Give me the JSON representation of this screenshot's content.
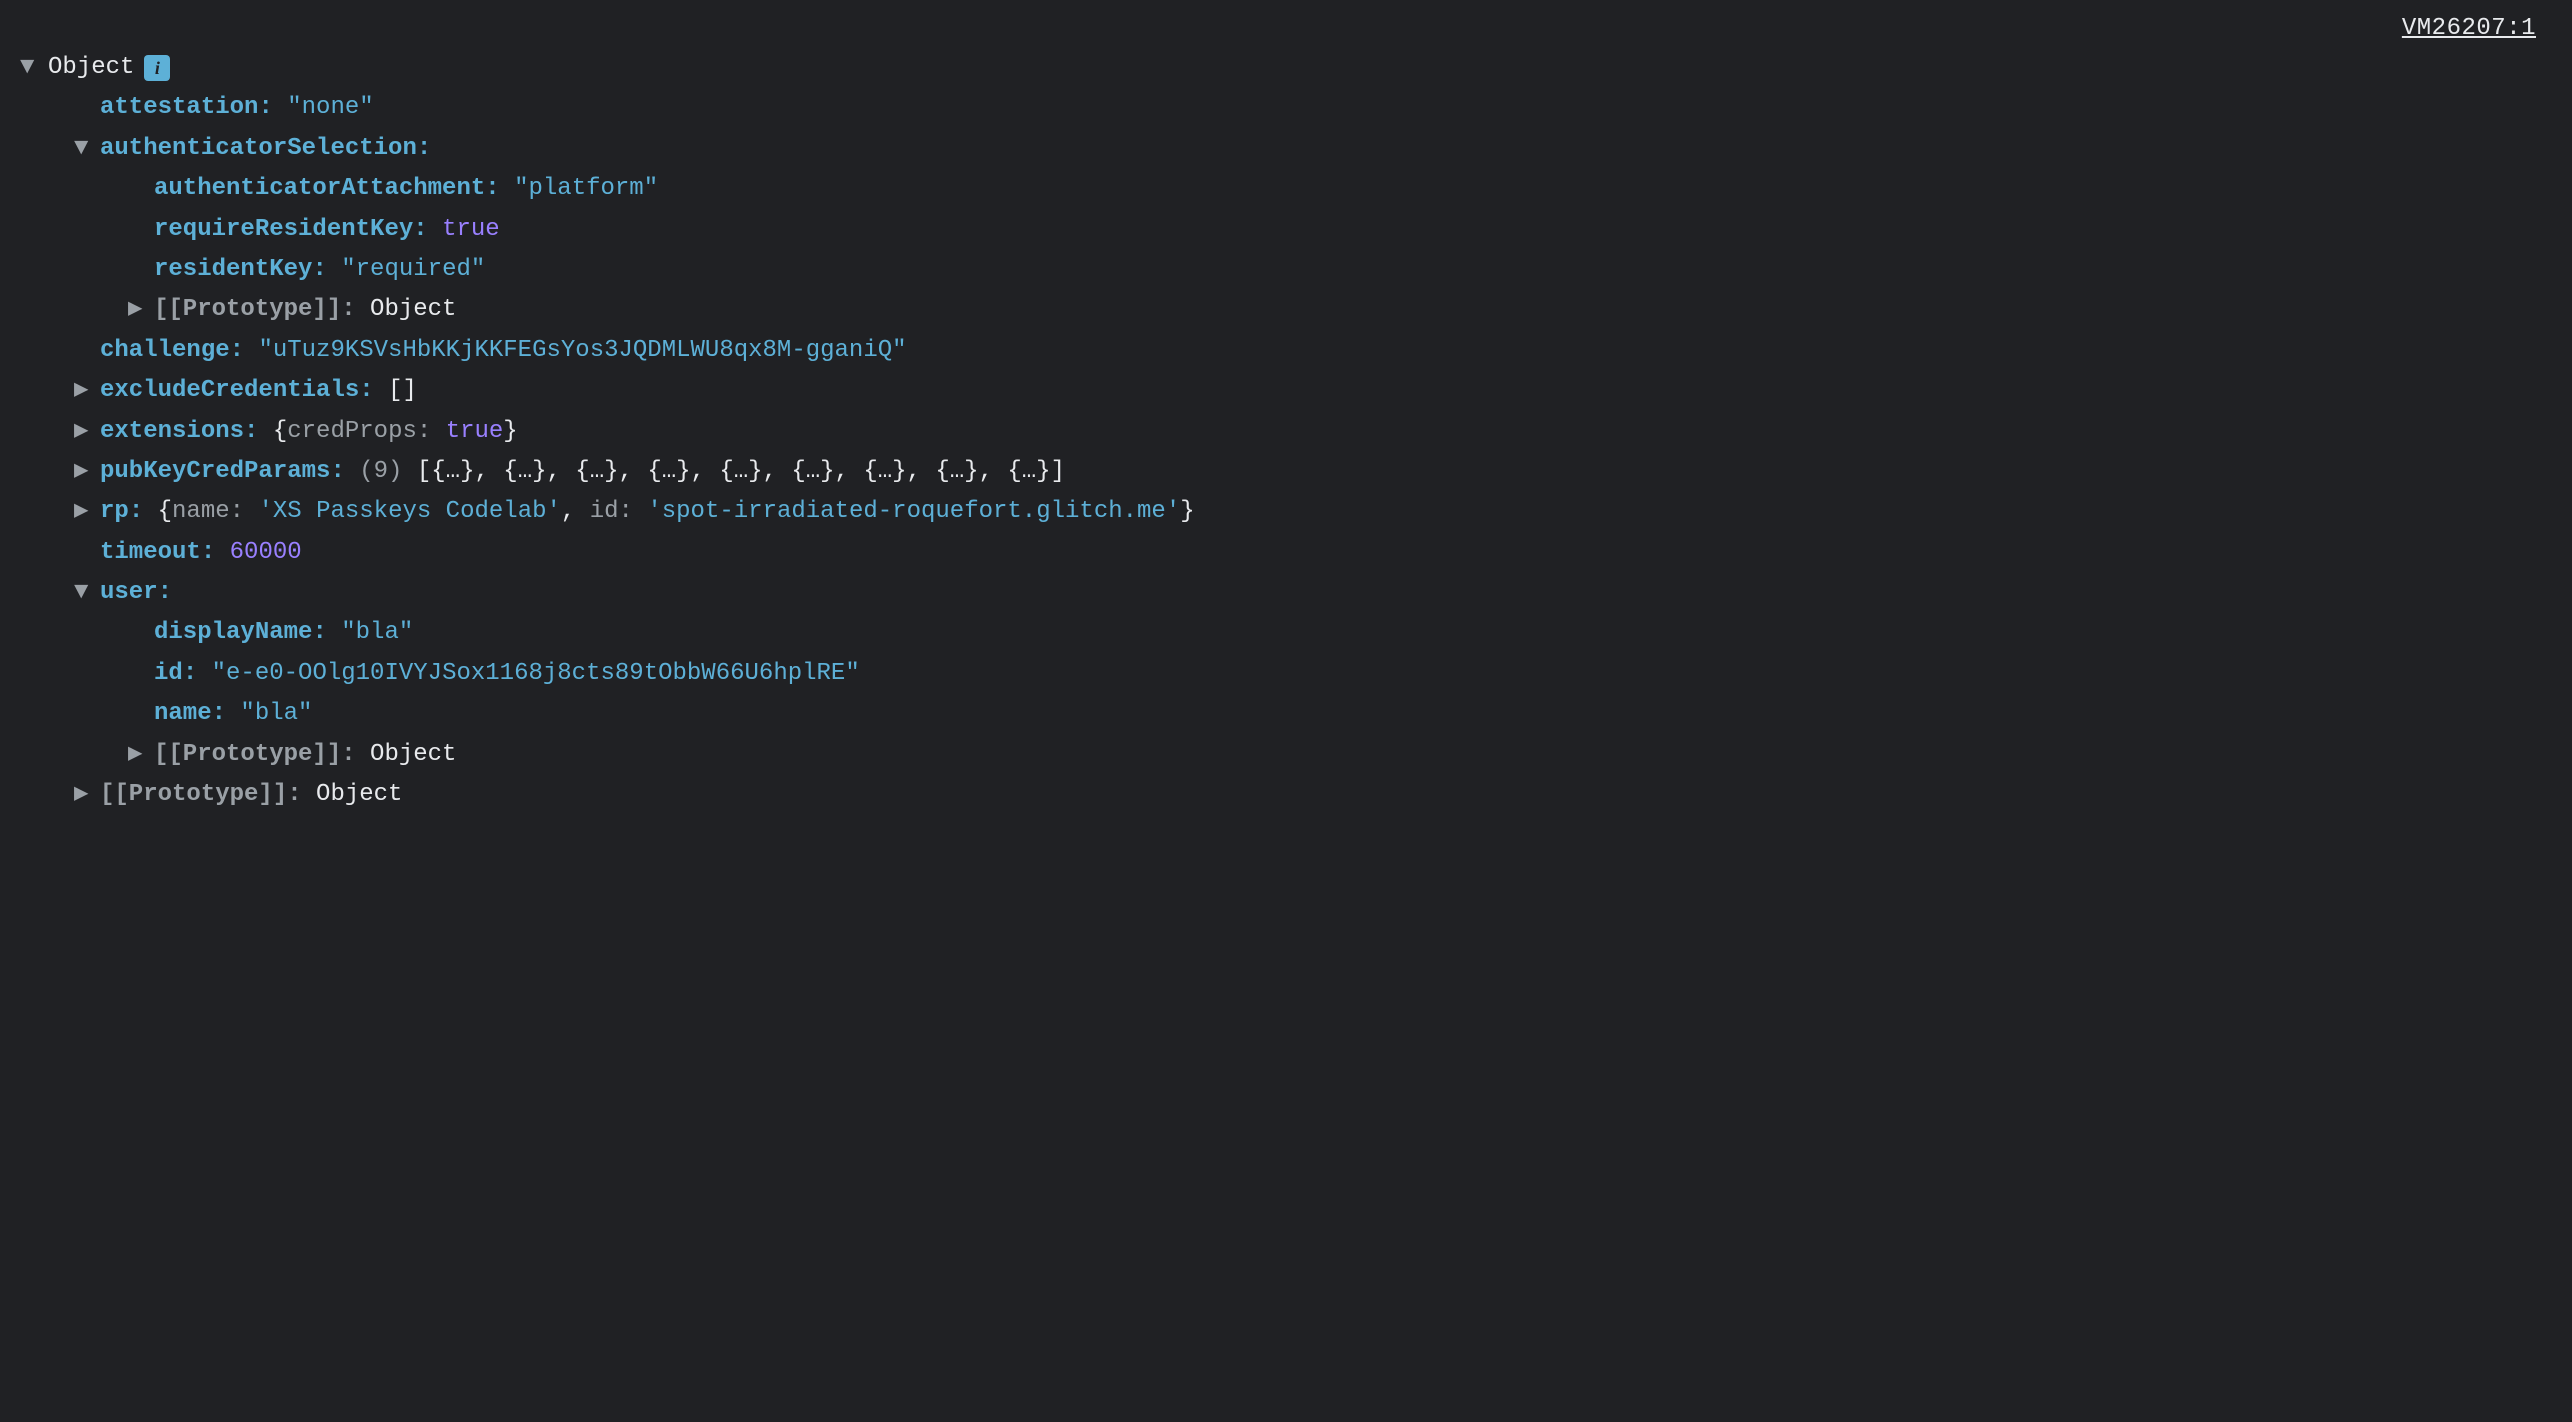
{
  "source_link": "VM26207:1",
  "header": {
    "label": "Object"
  },
  "triangles": {
    "down": "▼",
    "right": "▶"
  },
  "info_symbol": "i",
  "obj": {
    "attestation": {
      "key": "attestation",
      "value": "\"none\""
    },
    "authenticatorSelection": {
      "key": "authenticatorSelection",
      "authenticatorAttachment": {
        "key": "authenticatorAttachment",
        "value": "\"platform\""
      },
      "requireResidentKey": {
        "key": "requireResidentKey",
        "value": "true"
      },
      "residentKey": {
        "key": "residentKey",
        "value": "\"required\""
      },
      "proto": {
        "key": "[[Prototype]]",
        "value": "Object"
      }
    },
    "challenge": {
      "key": "challenge",
      "value": "\"uTuz9KSVsHbKKjKKFEGsYos3JQDMLWU8qx8M-gganiQ\""
    },
    "excludeCredentials": {
      "key": "excludeCredentials",
      "value": "[]"
    },
    "extensions": {
      "key": "extensions",
      "inner_key": "credProps",
      "inner_value": "true"
    },
    "pubKeyCredParams": {
      "key": "pubKeyCredParams",
      "count": "(9)",
      "value": "[{…}, {…}, {…}, {…}, {…}, {…}, {…}, {…}, {…}]"
    },
    "rp": {
      "key": "rp",
      "name_key": "name",
      "name_value": "'XS Passkeys Codelab'",
      "id_key": "id",
      "id_value": "'spot-irradiated-roquefort.glitch.me'"
    },
    "timeout": {
      "key": "timeout",
      "value": "60000"
    },
    "user": {
      "key": "user",
      "displayName": {
        "key": "displayName",
        "value": "\"bla\""
      },
      "id": {
        "key": "id",
        "value": "\"e-e0-OOlg10IVYJSox1168j8cts89tObbW66U6hplRE\""
      },
      "name": {
        "key": "name",
        "value": "\"bla\""
      },
      "proto": {
        "key": "[[Prototype]]",
        "value": "Object"
      }
    },
    "proto": {
      "key": "[[Prototype]]",
      "value": "Object"
    }
  }
}
